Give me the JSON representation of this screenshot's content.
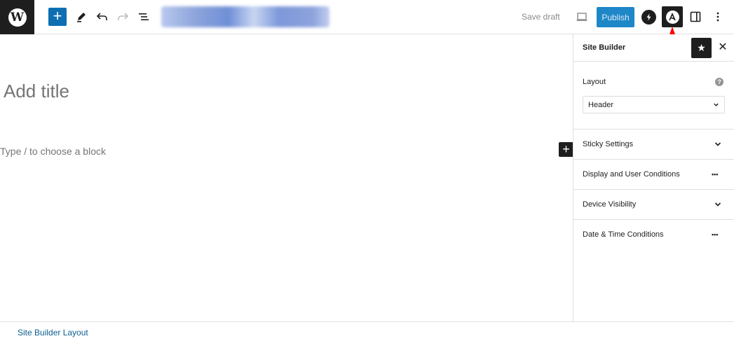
{
  "toolbar": {
    "logo_letter": "W",
    "add_block_symbol": "+",
    "save_draft_label": "Save draft",
    "publish_label": "Publish"
  },
  "editor": {
    "title_placeholder": "Add title",
    "block_placeholder": "Type / to choose a block",
    "inline_add_symbol": "+"
  },
  "sidebar": {
    "title": "Site Builder",
    "star_symbol": "★",
    "close_symbol": "✕",
    "layout": {
      "label": "Layout",
      "help_symbol": "?",
      "selected": "Header"
    },
    "panels": [
      {
        "label": "Sticky Settings",
        "control": "chevron-down-icon"
      },
      {
        "label": "Display and User Conditions",
        "control": "more-icon"
      },
      {
        "label": "Device Visibility",
        "control": "chevron-down-icon"
      },
      {
        "label": "Date & Time Conditions",
        "control": "more-icon"
      }
    ],
    "more_symbol": "•••"
  },
  "footer": {
    "link_label": "Site Builder Layout"
  },
  "colors": {
    "accent": "#0d6fb2",
    "publish": "#1e87c8",
    "arrow": "#ff0000",
    "dark": "#1e1e1e"
  }
}
